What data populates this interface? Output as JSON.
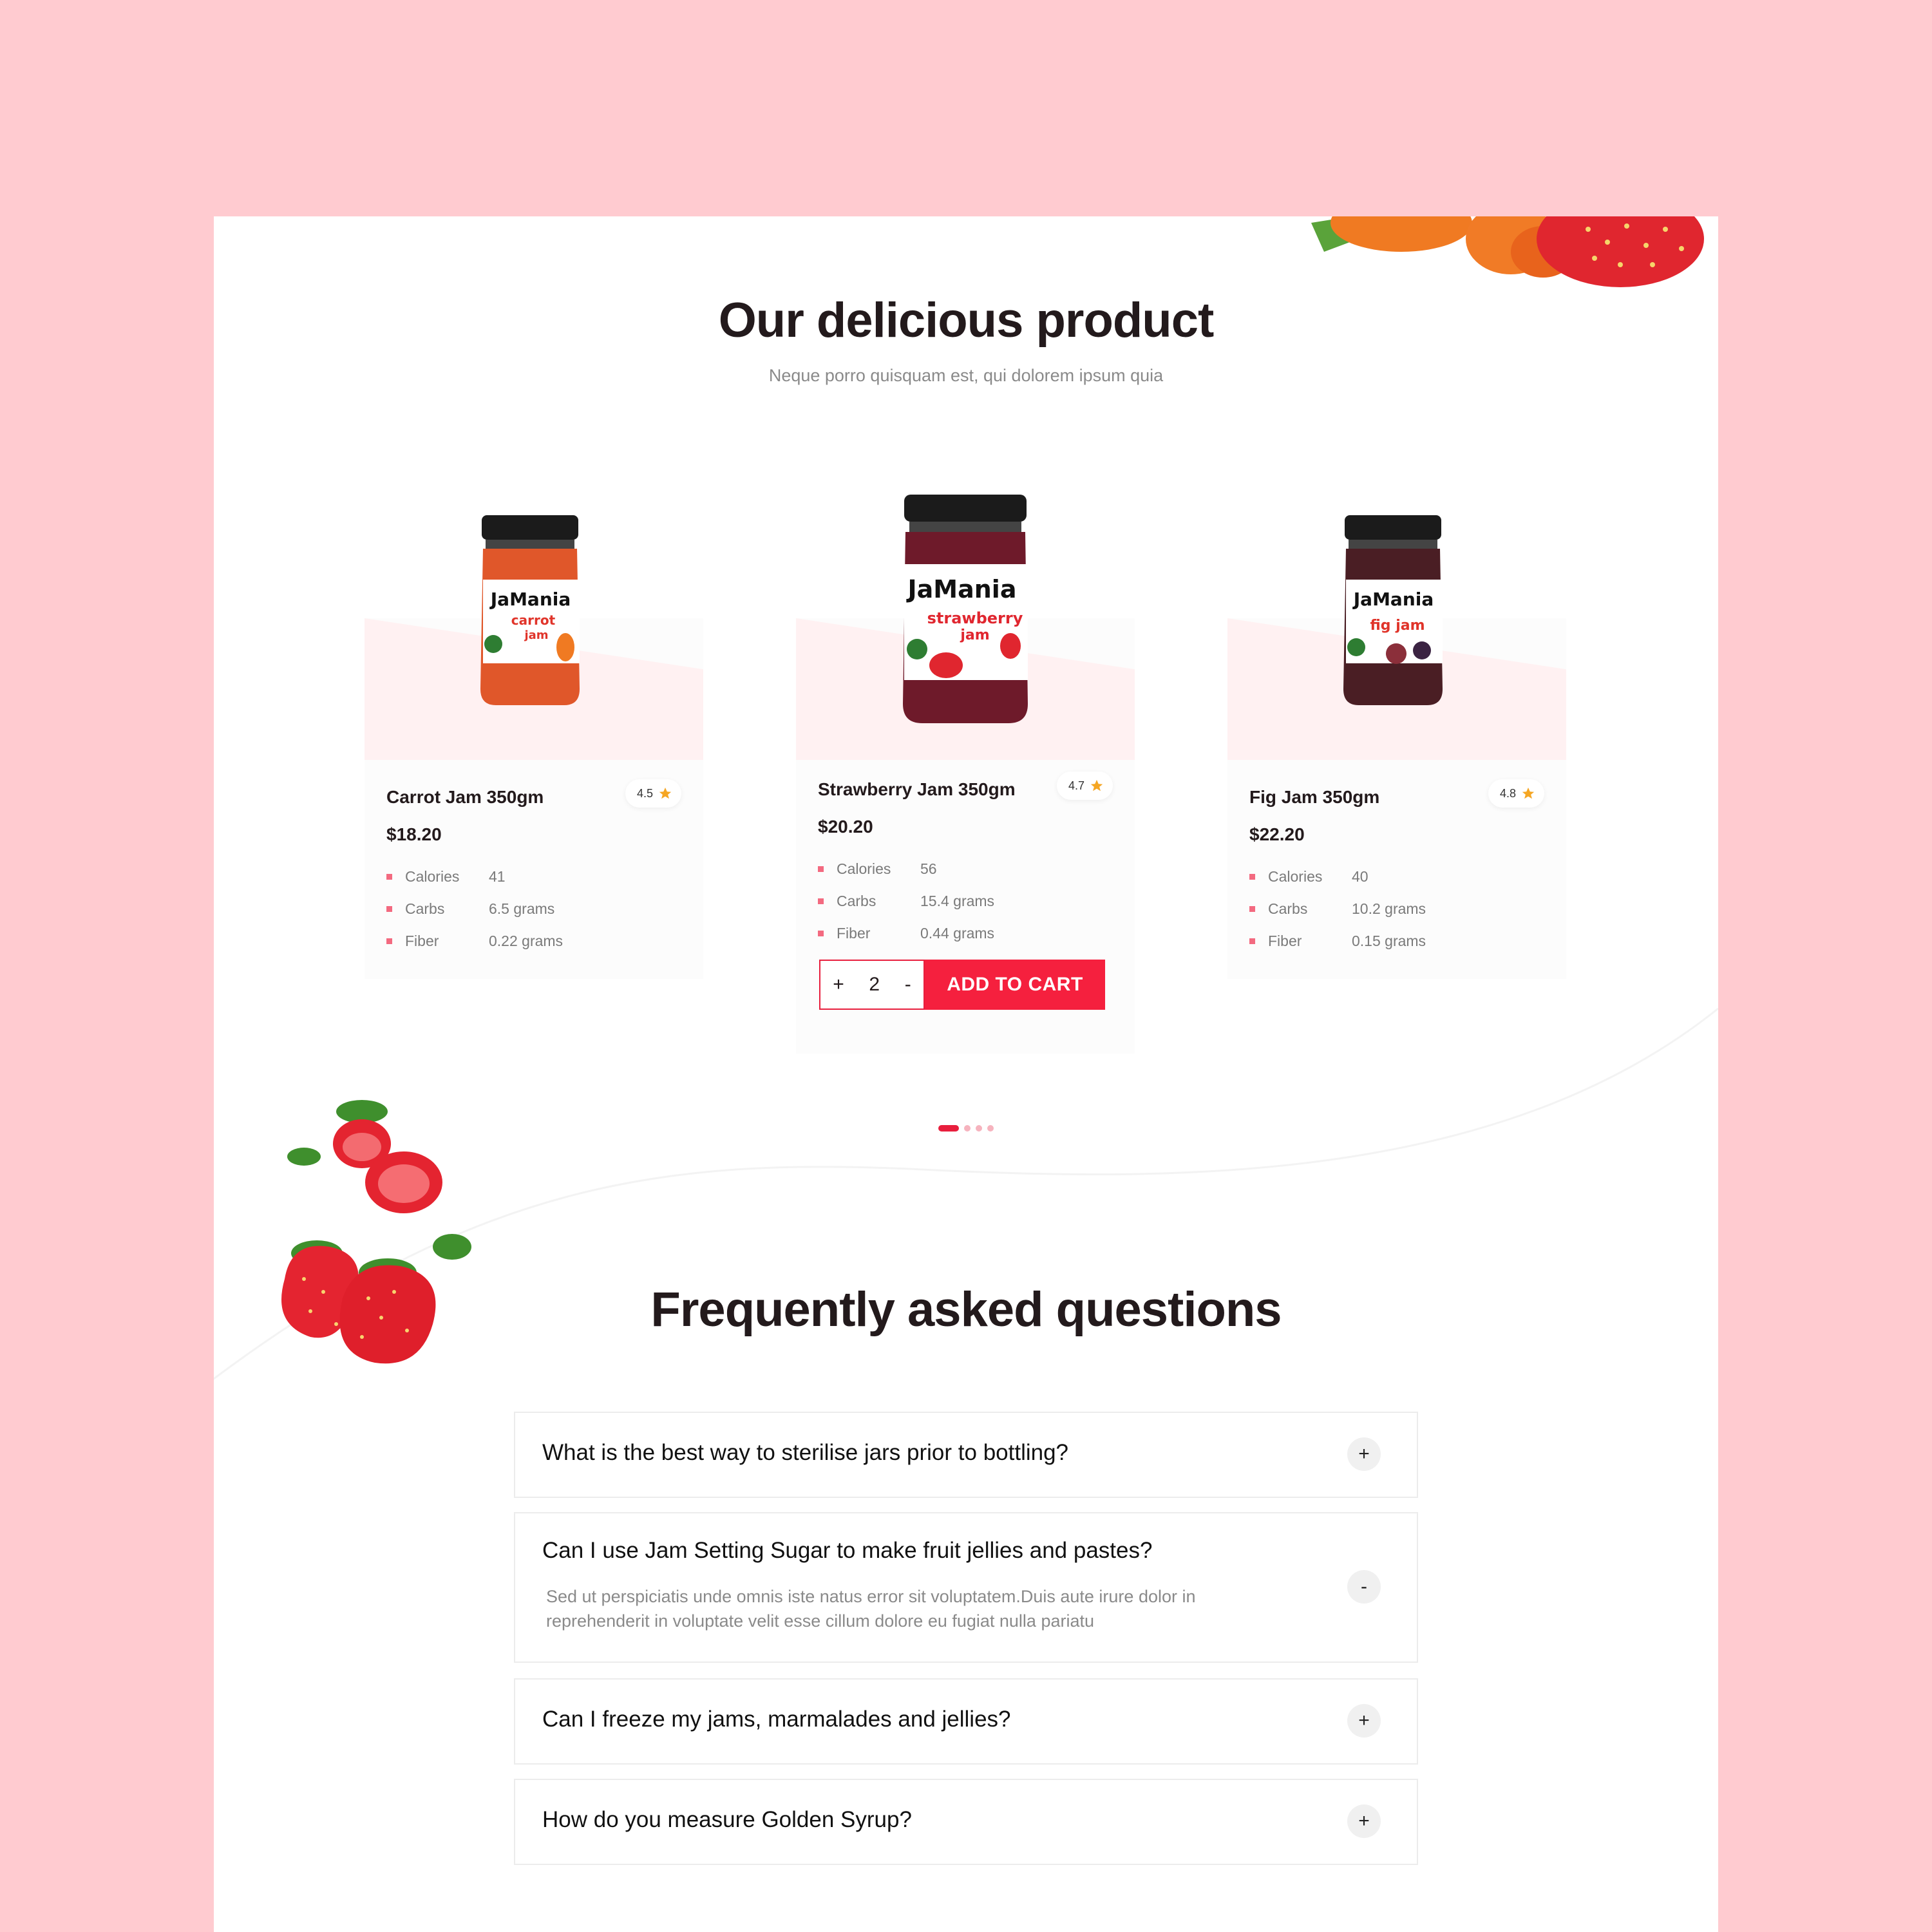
{
  "products_section": {
    "title": "Our delicious product",
    "subtitle": "Neque porro quisquam est, qui dolorem ipsum quia"
  },
  "products": [
    {
      "name": "Carrot Jam 350gm",
      "price": "$18.20",
      "rating": "4.5",
      "brand": "JaMania",
      "flavor": "carrot jam",
      "jar_color": "#e0572a",
      "nutrition": [
        {
          "label": "Calories",
          "value": "41"
        },
        {
          "label": "Carbs",
          "value": "6.5 grams"
        },
        {
          "label": "Fiber",
          "value": "0.22 grams"
        }
      ]
    },
    {
      "name": "Strawberry Jam 350gm",
      "price": "$20.20",
      "rating": "4.7",
      "brand": "JaMania",
      "flavor": "strawberry jam",
      "jar_color": "#6e1a2a",
      "nutrition": [
        {
          "label": "Calories",
          "value": "56"
        },
        {
          "label": "Carbs",
          "value": "15.4 grams"
        },
        {
          "label": "Fiber",
          "value": "0.44 grams"
        }
      ],
      "quantity": "2",
      "qty_plus": "+",
      "qty_minus": "-",
      "add_to_cart": "ADD TO CART"
    },
    {
      "name": "Fig Jam 350gm",
      "price": "$22.20",
      "rating": "4.8",
      "brand": "JaMania",
      "flavor": "fig jam",
      "jar_color": "#4a1e24",
      "nutrition": [
        {
          "label": "Calories",
          "value": "40"
        },
        {
          "label": "Carbs",
          "value": "10.2 grams"
        },
        {
          "label": "Fiber",
          "value": "0.15 grams"
        }
      ]
    }
  ],
  "carousel": {
    "pages": 4,
    "active": 1
  },
  "faq": {
    "title": "Frequently asked questions",
    "items": [
      {
        "question": "What is the best way to sterilise jars prior to bottling?",
        "toggle": "+",
        "expanded": false
      },
      {
        "question": "Can I use Jam Setting Sugar to make fruit jellies and pastes?",
        "answer": "Sed ut perspiciatis unde omnis iste natus error sit voluptatem.Duis aute irure dolor in reprehenderit in voluptate velit esse cillum dolore eu fugiat nulla pariatu",
        "toggle": "-",
        "expanded": true
      },
      {
        "question": "Can I freeze my jams, marmalades and jellies?",
        "toggle": "+",
        "expanded": false
      },
      {
        "question": "How do you measure Golden Syrup?",
        "toggle": "+",
        "expanded": false
      }
    ]
  },
  "colors": {
    "background": "#ffcbd0",
    "accent": "#f5203e",
    "star": "#f5a623"
  }
}
